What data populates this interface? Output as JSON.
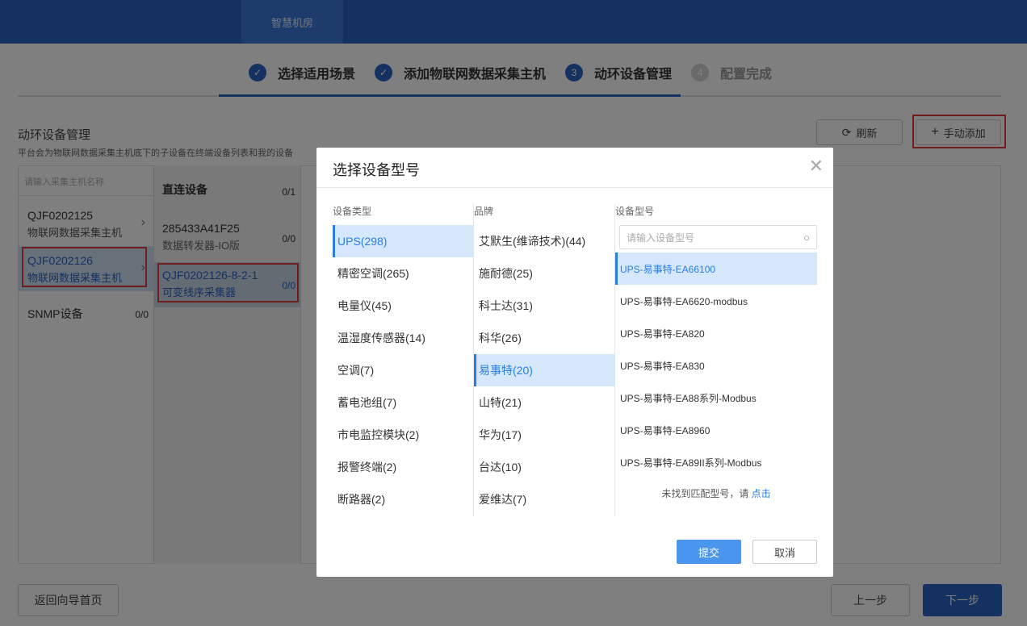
{
  "topbar": {
    "tab_label": "智慧机房"
  },
  "steps": [
    {
      "label": "选择适用场景",
      "state": "done",
      "mark": "✓"
    },
    {
      "label": "添加物联网数据采集主机",
      "state": "done",
      "mark": "✓"
    },
    {
      "label": "动环设备管理",
      "state": "current",
      "mark": "3"
    },
    {
      "label": "配置完成",
      "state": "todo",
      "mark": "4"
    }
  ],
  "section": {
    "title": "动环设备管理",
    "desc": "平台会为物联网数据采集主机底下的子设备在终端设备列表和我的设备",
    "refresh_label": "刷新",
    "add_label": "手动添加"
  },
  "hosts": {
    "search_placeholder": "请输入采集主机名称",
    "items": [
      {
        "name": "QJF0202125",
        "sub": "物联网数据采集主机"
      },
      {
        "name": "QJF0202126",
        "sub": "物联网数据采集主机"
      },
      {
        "name": "SNMP设备",
        "count": "0/0"
      }
    ]
  },
  "devices": {
    "items": [
      {
        "name": "直连设备",
        "count": "0/1"
      },
      {
        "name": "285433A41F25",
        "sub": "数据转发器-IO版",
        "count": "0/0"
      },
      {
        "name": "QJF0202126-8-2-1",
        "sub": "可变线序采集器",
        "count": "0/0"
      }
    ]
  },
  "footer": {
    "back_label": "返回向导首页",
    "prev_label": "上一步",
    "next_label": "下一步"
  },
  "modal": {
    "title": "选择设备型号",
    "type_header": "设备类型",
    "brand_header": "品牌",
    "model_header": "设备型号",
    "model_search_placeholder": "请输入设备型号",
    "types": [
      "UPS(298)",
      "精密空调(265)",
      "电量仪(45)",
      "温湿度传感器(14)",
      "空调(7)",
      "蓄电池组(7)",
      "市电监控模块(2)",
      "报警终端(2)",
      "断路器(2)"
    ],
    "brands": [
      "艾默生(维谛技术)(44)",
      "施耐德(25)",
      "科士达(31)",
      "科华(26)",
      "易事特(20)",
      "山特(21)",
      "华为(17)",
      "台达(10)",
      "爱维达(7)"
    ],
    "models": [
      "UPS-易事特-EA66100",
      "UPS-易事特-EA6620-modbus",
      "UPS-易事特-EA820",
      "UPS-易事特-EA830",
      "UPS-易事特-EA88系列-Modbus",
      "UPS-易事特-EA8960",
      "UPS-易事特-EA89II系列-Modbus"
    ],
    "not_found_text": "未找到匹配型号，请",
    "not_found_link": "点击",
    "submit_label": "提交",
    "cancel_label": "取消"
  }
}
